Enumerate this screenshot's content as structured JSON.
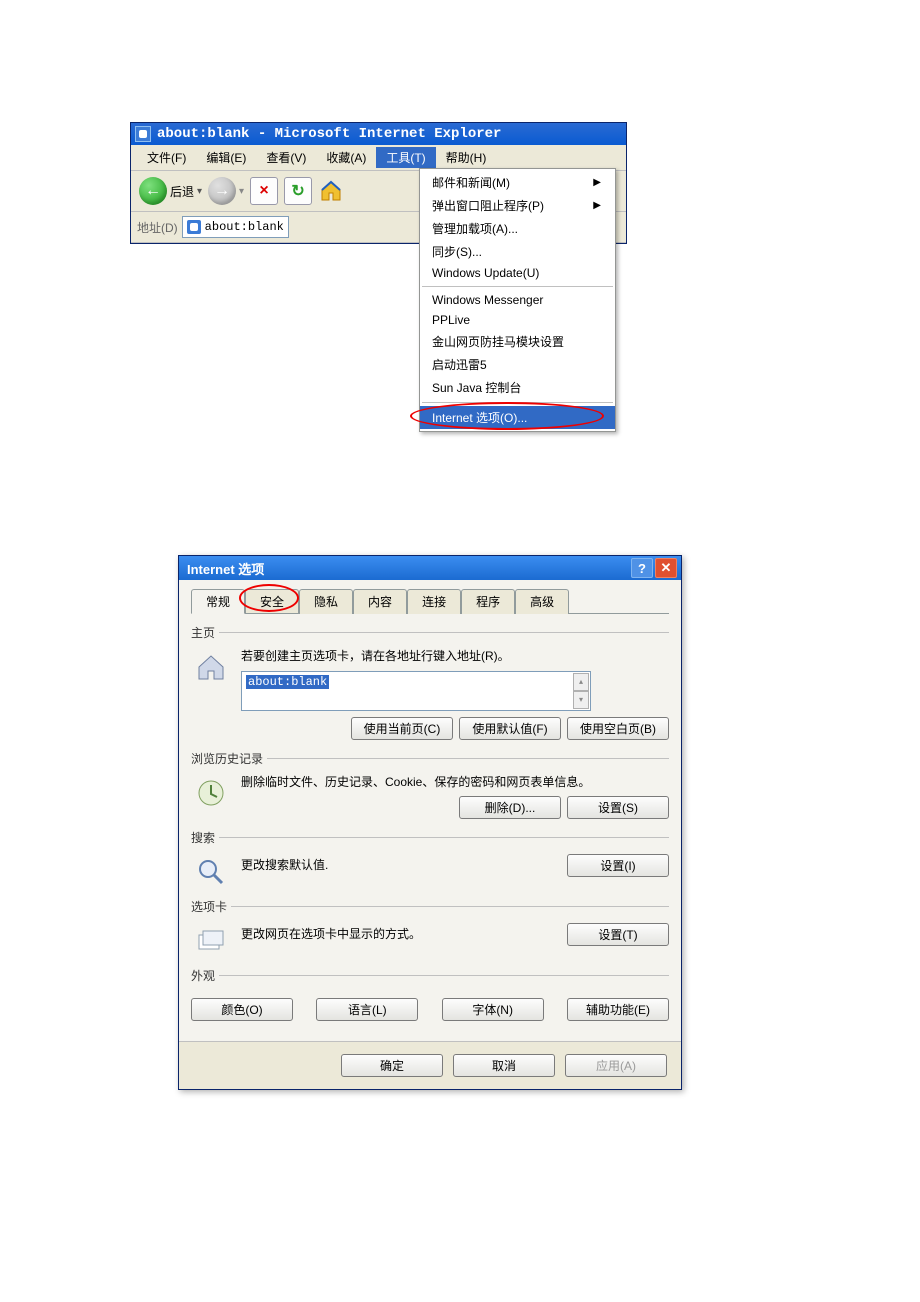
{
  "ie": {
    "title": "about:blank - Microsoft Internet Explorer",
    "menubar": {
      "file": "文件(F)",
      "edit": "编辑(E)",
      "view": "查看(V)",
      "fav": "收藏(A)",
      "tools": "工具(T)",
      "help": "帮助(H)"
    },
    "toolbar": {
      "back": "后退",
      "dropdown_arrow": "▾"
    },
    "addressbar": {
      "label": "地址(D)",
      "value": "about:blank"
    },
    "tools_menu": {
      "mail_news": "邮件和新闻(M)",
      "popup_blocker": "弹出窗口阻止程序(P)",
      "manage_addons": "管理加载项(A)...",
      "sync": "同步(S)...",
      "win_update": "Windows Update(U)",
      "win_messenger": "Windows Messenger",
      "pplive": "PPLive",
      "jinshan": "金山网页防挂马模块设置",
      "xunlei": "启动迅雷5",
      "sunjava": "Sun Java 控制台",
      "inet_options": "Internet 选项(O)..."
    }
  },
  "options": {
    "title": "Internet 选项",
    "help_symbol": "?",
    "close_symbol": "✕",
    "tabs": {
      "general": "常规",
      "security": "安全",
      "privacy": "隐私",
      "content": "内容",
      "conn": "连接",
      "programs": "程序",
      "advanced": "高级"
    },
    "home": {
      "legend": "主页",
      "desc": "若要创建主页选项卡，请在各地址行键入地址(R)。",
      "value": "about:blank",
      "btn_current": "使用当前页(C)",
      "btn_default": "使用默认值(F)",
      "btn_blank": "使用空白页(B)"
    },
    "history": {
      "legend": "浏览历史记录",
      "desc": "删除临时文件、历史记录、Cookie、保存的密码和网页表单信息。",
      "btn_delete": "删除(D)...",
      "btn_settings": "设置(S)"
    },
    "search": {
      "legend": "搜索",
      "desc": "更改搜索默认值.",
      "btn_settings": "设置(I)"
    },
    "tabs_section": {
      "legend": "选项卡",
      "desc": "更改网页在选项卡中显示的方式。",
      "btn_settings": "设置(T)"
    },
    "appearance": {
      "legend": "外观",
      "btn_colors": "颜色(O)",
      "btn_lang": "语言(L)",
      "btn_fonts": "字体(N)",
      "btn_access": "辅助功能(E)"
    },
    "footer": {
      "ok": "确定",
      "cancel": "取消",
      "apply": "应用(A)"
    }
  }
}
